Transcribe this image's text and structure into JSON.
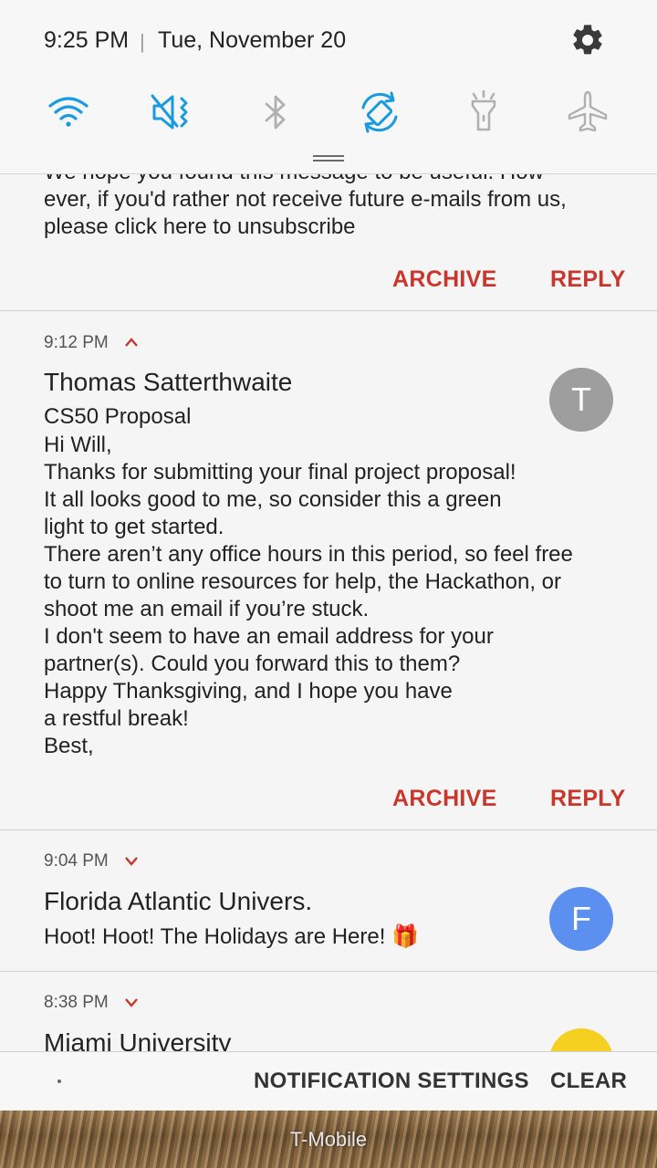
{
  "status": {
    "time": "9:25 PM",
    "separator": "|",
    "date": "Tue, November 20"
  },
  "quick_settings": [
    {
      "name": "wifi-icon",
      "active": true
    },
    {
      "name": "mute-icon",
      "active": true
    },
    {
      "name": "bluetooth-icon",
      "active": false
    },
    {
      "name": "auto-rotate-icon",
      "active": true
    },
    {
      "name": "flashlight-icon",
      "active": false
    },
    {
      "name": "airplane-mode-icon",
      "active": false
    }
  ],
  "colors": {
    "accent_blue": "#1a9ae0",
    "inactive_gray": "#b0b0b0",
    "action_red": "#c9372c"
  },
  "notifications": [
    {
      "body_lines": [
        "We hope you found this message to be useful. How-",
        "ever, if you'd rather not receive future e-mails from us,",
        "please click here to unsubscribe"
      ],
      "actions": {
        "archive": "ARCHIVE",
        "reply": "REPLY"
      }
    },
    {
      "time": "9:12 PM",
      "sender": "Thomas Satterthwaite",
      "subject": "CS50 Proposal",
      "avatar_letter": "T",
      "avatar_color": "#9e9e9e",
      "expanded": true,
      "body_lines": [
        "Hi Will,",
        "Thanks for submitting your final project proposal!",
        "It all looks good to me, so consider this a green",
        "light to get started.",
        "There aren’t any office hours in this period, so feel free",
        "to turn to online resources for help, the Hackathon, or",
        "shoot me an email if you’re stuck.",
        "I don't seem to have an email address for your",
        "partner(s). Could you forward this to them?",
        "Happy Thanksgiving, and I hope you have",
        "a restful break!",
        "Best,"
      ],
      "actions": {
        "archive": "ARCHIVE",
        "reply": "REPLY"
      }
    },
    {
      "time": "9:04 PM",
      "sender": "Florida Atlantic Univers.",
      "subject": "Hoot! Hoot! The Holidays are Here! 🎁",
      "avatar_letter": "F",
      "avatar_color": "#5b8ff0",
      "expanded": false
    },
    {
      "time": "8:38 PM",
      "sender": "Miami University",
      "avatar_color": "#f5d020",
      "expanded": false
    }
  ],
  "bottom_bar": {
    "notification_settings": "NOTIFICATION SETTINGS",
    "clear": "CLEAR"
  },
  "carrier": "T-Mobile"
}
